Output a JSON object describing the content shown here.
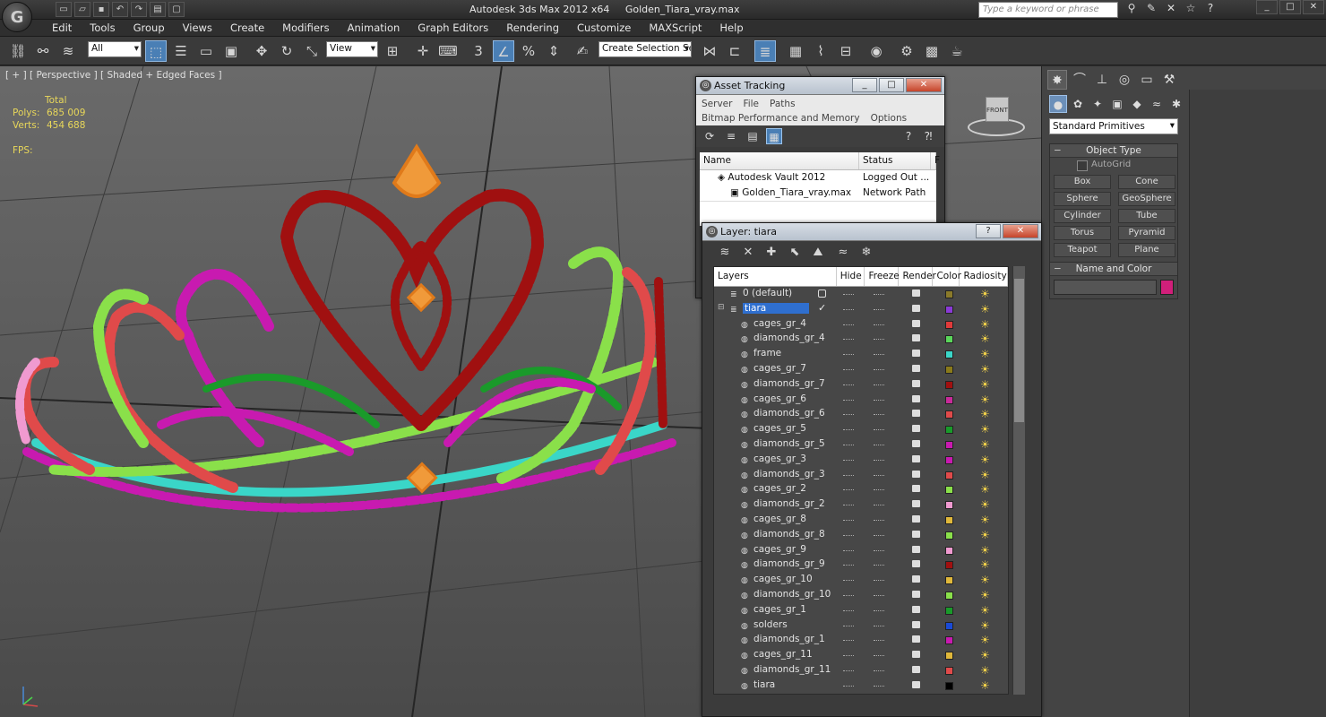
{
  "titlebar": {
    "app_name": "Autodesk 3ds Max  2012 x64",
    "file_name": "Golden_Tiara_vray.max",
    "search_placeholder": "Type a keyword or phrase",
    "app_logo": "G"
  },
  "menu": [
    "Edit",
    "Tools",
    "Group",
    "Views",
    "Create",
    "Modifiers",
    "Animation",
    "Graph Editors",
    "Rendering",
    "Customize",
    "MAXScript",
    "Help"
  ],
  "toolbar": {
    "filter_value": "All",
    "refcoord_value": "View",
    "selection_set_value": "Create Selection Se"
  },
  "viewport": {
    "label": "[ + ] [ Perspective ] [ Shaded + Edged Faces ]",
    "stats_header": "Total",
    "polys_label": "Polys:",
    "polys_value": "685 009",
    "verts_label": "Verts:",
    "verts_value": "454 688",
    "fps_label": "FPS:",
    "viewcube_label": "FRONT"
  },
  "command_panel": {
    "primitive_type": "Standard Primitives",
    "object_type_title": "Object Type",
    "autogrid_label": "AutoGrid",
    "object_buttons": [
      "Box",
      "Cone",
      "Sphere",
      "GeoSphere",
      "Cylinder",
      "Tube",
      "Torus",
      "Pyramid",
      "Teapot",
      "Plane"
    ],
    "name_color_title": "Name and Color",
    "object_color": "#d11f7a"
  },
  "asset_tracking": {
    "title": "Asset Tracking",
    "menu_row1": [
      "Server",
      "File",
      "Paths"
    ],
    "menu_row2": [
      "Bitmap Performance and Memory",
      "Options"
    ],
    "columns": [
      "Name",
      "Status",
      "F"
    ],
    "rows": [
      {
        "name": "Autodesk Vault 2012",
        "status": "Logged Out ..."
      },
      {
        "name": "Golden_Tiara_vray.max",
        "status": "Network Path"
      }
    ]
  },
  "layer_manager": {
    "title": "Layer: tiara",
    "help_label": "?",
    "columns": [
      "Layers",
      "Hide",
      "Freeze",
      "Render",
      "Color",
      "Radiosity"
    ],
    "layers": [
      {
        "name": "0 (default)",
        "color": "#8a7a2a",
        "level": 0
      },
      {
        "name": "tiara",
        "color": "#8a3ad6",
        "level": 0,
        "selected": true
      },
      {
        "name": "cages_gr_4",
        "color": "#e03a3a",
        "level": 1
      },
      {
        "name": "diamonds_gr_4",
        "color": "#5ad65a",
        "level": 1
      },
      {
        "name": "frame",
        "color": "#3ad6c8",
        "level": 1
      },
      {
        "name": "cages_gr_7",
        "color": "#8a7a1a",
        "level": 1
      },
      {
        "name": "diamonds_gr_7",
        "color": "#a01010",
        "level": 1
      },
      {
        "name": "cages_gr_6",
        "color": "#c82a9a",
        "level": 1
      },
      {
        "name": "diamonds_gr_6",
        "color": "#e04a4a",
        "level": 1
      },
      {
        "name": "cages_gr_5",
        "color": "#1a9a2a",
        "level": 1
      },
      {
        "name": "diamonds_gr_5",
        "color": "#c81ab0",
        "level": 1
      },
      {
        "name": "cages_gr_3",
        "color": "#c81ab0",
        "level": 1
      },
      {
        "name": "diamonds_gr_3",
        "color": "#e04a4a",
        "level": 1
      },
      {
        "name": "cages_gr_2",
        "color": "#8ae04a",
        "level": 1
      },
      {
        "name": "diamonds_gr_2",
        "color": "#f09ad0",
        "level": 1
      },
      {
        "name": "cages_gr_8",
        "color": "#e0b83a",
        "level": 1
      },
      {
        "name": "diamonds_gr_8",
        "color": "#8ae04a",
        "level": 1
      },
      {
        "name": "cages_gr_9",
        "color": "#f09ad0",
        "level": 1
      },
      {
        "name": "diamonds_gr_9",
        "color": "#a01010",
        "level": 1
      },
      {
        "name": "cages_gr_10",
        "color": "#e0b83a",
        "level": 1
      },
      {
        "name": "diamonds_gr_10",
        "color": "#8ae04a",
        "level": 1
      },
      {
        "name": "cages_gr_1",
        "color": "#1a9a2a",
        "level": 1
      },
      {
        "name": "solders",
        "color": "#1a4ad6",
        "level": 1
      },
      {
        "name": "diamonds_gr_1",
        "color": "#c81ab0",
        "level": 1
      },
      {
        "name": "cages_gr_11",
        "color": "#e0b83a",
        "level": 1
      },
      {
        "name": "diamonds_gr_11",
        "color": "#e04a4a",
        "level": 1
      },
      {
        "name": "tiara",
        "color": "#000000",
        "level": 1
      }
    ]
  }
}
